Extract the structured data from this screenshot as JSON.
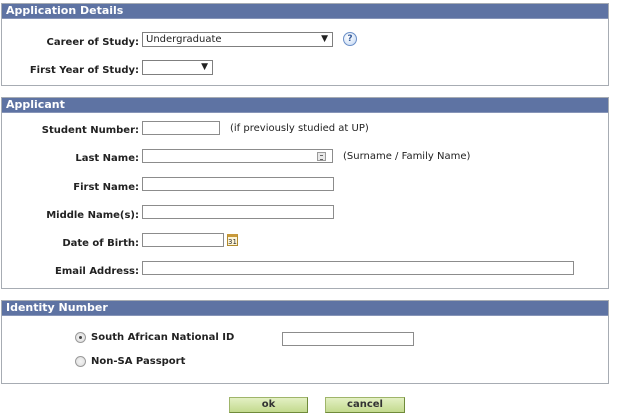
{
  "application_details": {
    "header": "Application Details",
    "career_label": "Career of Study:",
    "career_value": "Undergraduate",
    "first_year_label": "First Year of Study:",
    "first_year_value": "",
    "help_glyph": "?"
  },
  "applicant": {
    "header": "Applicant",
    "student_number_label": "Student Number:",
    "student_number_note": "(if previously studied at UP)",
    "student_number_value": "",
    "last_name_label": "Last Name:",
    "last_name_note": "(Surname / Family Name)",
    "last_name_value": "",
    "first_name_label": "First Name:",
    "first_name_value": "",
    "middle_names_label": "Middle Name(s):",
    "middle_names_value": "",
    "dob_label": "Date of Birth:",
    "dob_value": "",
    "calendar_glyph": "31",
    "email_label": "Email Address:",
    "email_value": ""
  },
  "identity": {
    "header": "Identity Number",
    "option_sa": "South African National ID",
    "option_passport": "Non-SA Passport",
    "selected": "South African National ID",
    "id_value": ""
  },
  "buttons": {
    "ok": "ok",
    "cancel": "cancel"
  },
  "icons": {
    "help": "help-question-icon",
    "lookup": "lookup-icon",
    "calendar": "calendar-icon",
    "dropdown": "chevron-down-icon"
  },
  "colors": {
    "section_header_bg": "#5e73a3",
    "button_bg": "#c3da8e"
  }
}
